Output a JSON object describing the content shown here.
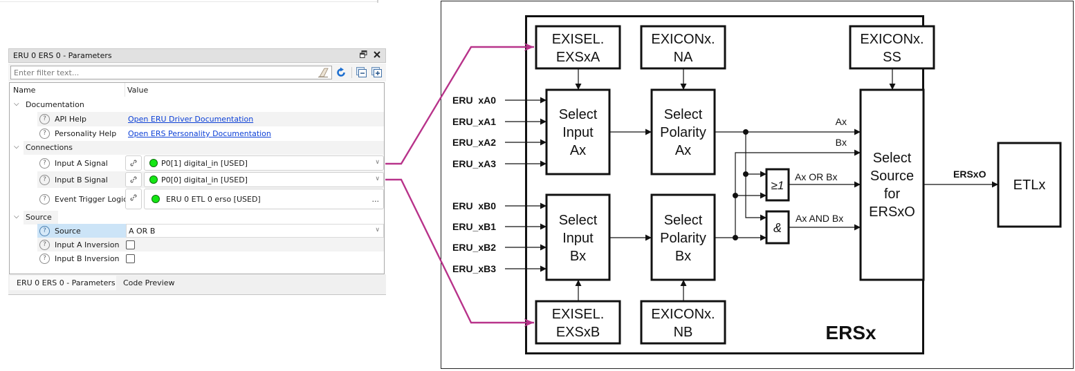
{
  "panel": {
    "title": "ERU 0 ERS 0 - Parameters",
    "restore_icon": "restore-window-icon",
    "close_icon": "close-icon",
    "filter": {
      "placeholder": "Enter filter text...",
      "value": ""
    },
    "toolbar_icons": [
      "eraser-icon",
      "refresh-icon",
      "collapse-all-icon",
      "expand-all-icon"
    ],
    "columns": {
      "name": "Name",
      "value": "Value"
    },
    "categories": {
      "documentation": {
        "label": "Documentation",
        "items": {
          "api_help": {
            "name": "API Help",
            "value": "Open ERU Driver Documentation"
          },
          "personality_help": {
            "name": "Personality Help",
            "value": "Open ERS Personality Documentation"
          }
        }
      },
      "connections": {
        "label": "Connections",
        "items": {
          "input_a": {
            "name": "Input A Signal",
            "value": "P0[1] digital_in [USED]",
            "status_color": "#14e614"
          },
          "input_b": {
            "name": "Input B Signal",
            "value": "P0[0] digital_in [USED]",
            "status_color": "#14e614"
          },
          "etl": {
            "name": "Event Trigger Logic",
            "value": "ERU 0 ETL 0 erso [USED]",
            "more": "...",
            "status_color": "#14e614"
          }
        }
      },
      "source": {
        "label": "Source",
        "items": {
          "source": {
            "name": "Source",
            "value": "A OR B"
          },
          "input_a_inversion": {
            "name": "Input A Inversion",
            "checked": false
          },
          "input_b_inversion": {
            "name": "Input B Inversion",
            "checked": false
          }
        }
      }
    },
    "help_glyph": "?",
    "tabs": [
      {
        "label": "ERU 0 ERS 0 - Parameters",
        "active": true
      },
      {
        "label": "Code Preview",
        "active": false
      }
    ]
  },
  "diagram": {
    "callout_color": "#b8338a",
    "block_title": "ERSx",
    "registers": {
      "exsxa": [
        "EXISEL.",
        "EXSxA"
      ],
      "na": [
        "EXICONx.",
        "NA"
      ],
      "ss": [
        "EXICONx.",
        "SS"
      ],
      "exsxb": [
        "EXISEL.",
        "EXSxB"
      ],
      "nb": [
        "EXICONx.",
        "NB"
      ]
    },
    "blocks": {
      "select_input_a": [
        "Select",
        "Input",
        "Ax"
      ],
      "select_polarity_a": [
        "Select",
        "Polarity",
        "Ax"
      ],
      "select_input_b": [
        "Select",
        "Input",
        "Bx"
      ],
      "select_polarity_b": [
        "Select",
        "Polarity",
        "Bx"
      ],
      "select_source": [
        "Select",
        "Source",
        "for",
        "ERSxO"
      ],
      "etl": [
        "ETLx"
      ]
    },
    "inputs_a": [
      "ERU  xA0",
      "ERU_xA1",
      "ERU_xA2",
      "ERU_xA3"
    ],
    "inputs_b": [
      "ERU  xB0",
      "ERU_xB1",
      "ERU_xB2",
      "ERU_xB3"
    ],
    "gates": {
      "or": "≥1",
      "and": "&"
    },
    "signals": {
      "ax": "Ax",
      "bx": "Bx",
      "or": "Ax OR Bx",
      "and": "Ax AND Bx",
      "out": "ERSxO"
    }
  }
}
